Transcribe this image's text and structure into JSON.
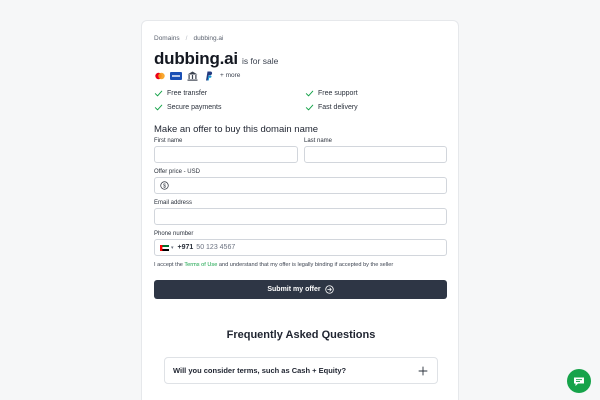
{
  "breadcrumb": {
    "root": "Domains",
    "separator": "/",
    "current": "dubbing.ai"
  },
  "header": {
    "domain": "dubbing.ai",
    "status": "is for sale"
  },
  "payments": {
    "icons": [
      "mastercard-icon",
      "visa-icon",
      "bank-icon",
      "paypal-icon"
    ],
    "more": "+ more"
  },
  "features": [
    "Free transfer",
    "Free support",
    "Secure payments",
    "Fast delivery"
  ],
  "offer_form": {
    "heading": "Make an offer to buy this domain name",
    "first_name_label": "First name",
    "last_name_label": "Last name",
    "price_label": "Offer price - USD",
    "email_label": "Email address",
    "phone_label": "Phone number",
    "phone_code": "+971",
    "phone_placeholder": "50 123 4567",
    "terms_before": "I accept the",
    "terms_link": "Terms of Use",
    "terms_after": "and understand that my offer is legally binding if accepted by the seller",
    "submit_label": "Submit my offer"
  },
  "faq": {
    "title": "Frequently Asked Questions",
    "items": [
      {
        "question": "Will you consider terms, such as Cash + Equity?"
      }
    ]
  },
  "colors": {
    "accent": "#16a34a",
    "button": "#2e3645",
    "border": "#d2d6dc"
  }
}
